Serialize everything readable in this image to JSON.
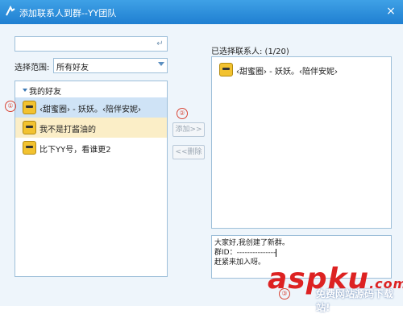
{
  "window": {
    "title": "添加联系人到群--YY团队",
    "close_label": "×"
  },
  "search": {
    "value": "",
    "placeholder": ""
  },
  "range": {
    "label": "选择范围:",
    "selected": "所有好友"
  },
  "friends": {
    "group_label": "我的好友",
    "items": [
      {
        "name": "‹甜蜜圈›      - 妖妖。‹陪伴安妮›"
      },
      {
        "name": "我不是打酱油的"
      },
      {
        "name": "比下YY号，看谁更2"
      }
    ]
  },
  "actions": {
    "add_label": "添加>>",
    "remove_label": "<<删除"
  },
  "selected": {
    "header": "已选择联系人: (1/20)",
    "items": [
      {
        "name": "‹甜蜜圈›      - 妖妖。‹陪伴安妮›"
      }
    ]
  },
  "message": {
    "line1": "大家好,我创建了新群。",
    "line2": "群ID：---------------",
    "line3": "赶紧来加入呀。"
  },
  "markers": [
    "①",
    "②",
    "③"
  ],
  "watermark": {
    "text": "aspku",
    "com": ".com",
    "subtext": "免费网站源码下载站!"
  },
  "colors": {
    "titlebar": "#2b8ddb",
    "selection": "#cfe3f6",
    "hover": "#fbeec7",
    "marker": "#d94535",
    "watermark": "#dd2222"
  }
}
